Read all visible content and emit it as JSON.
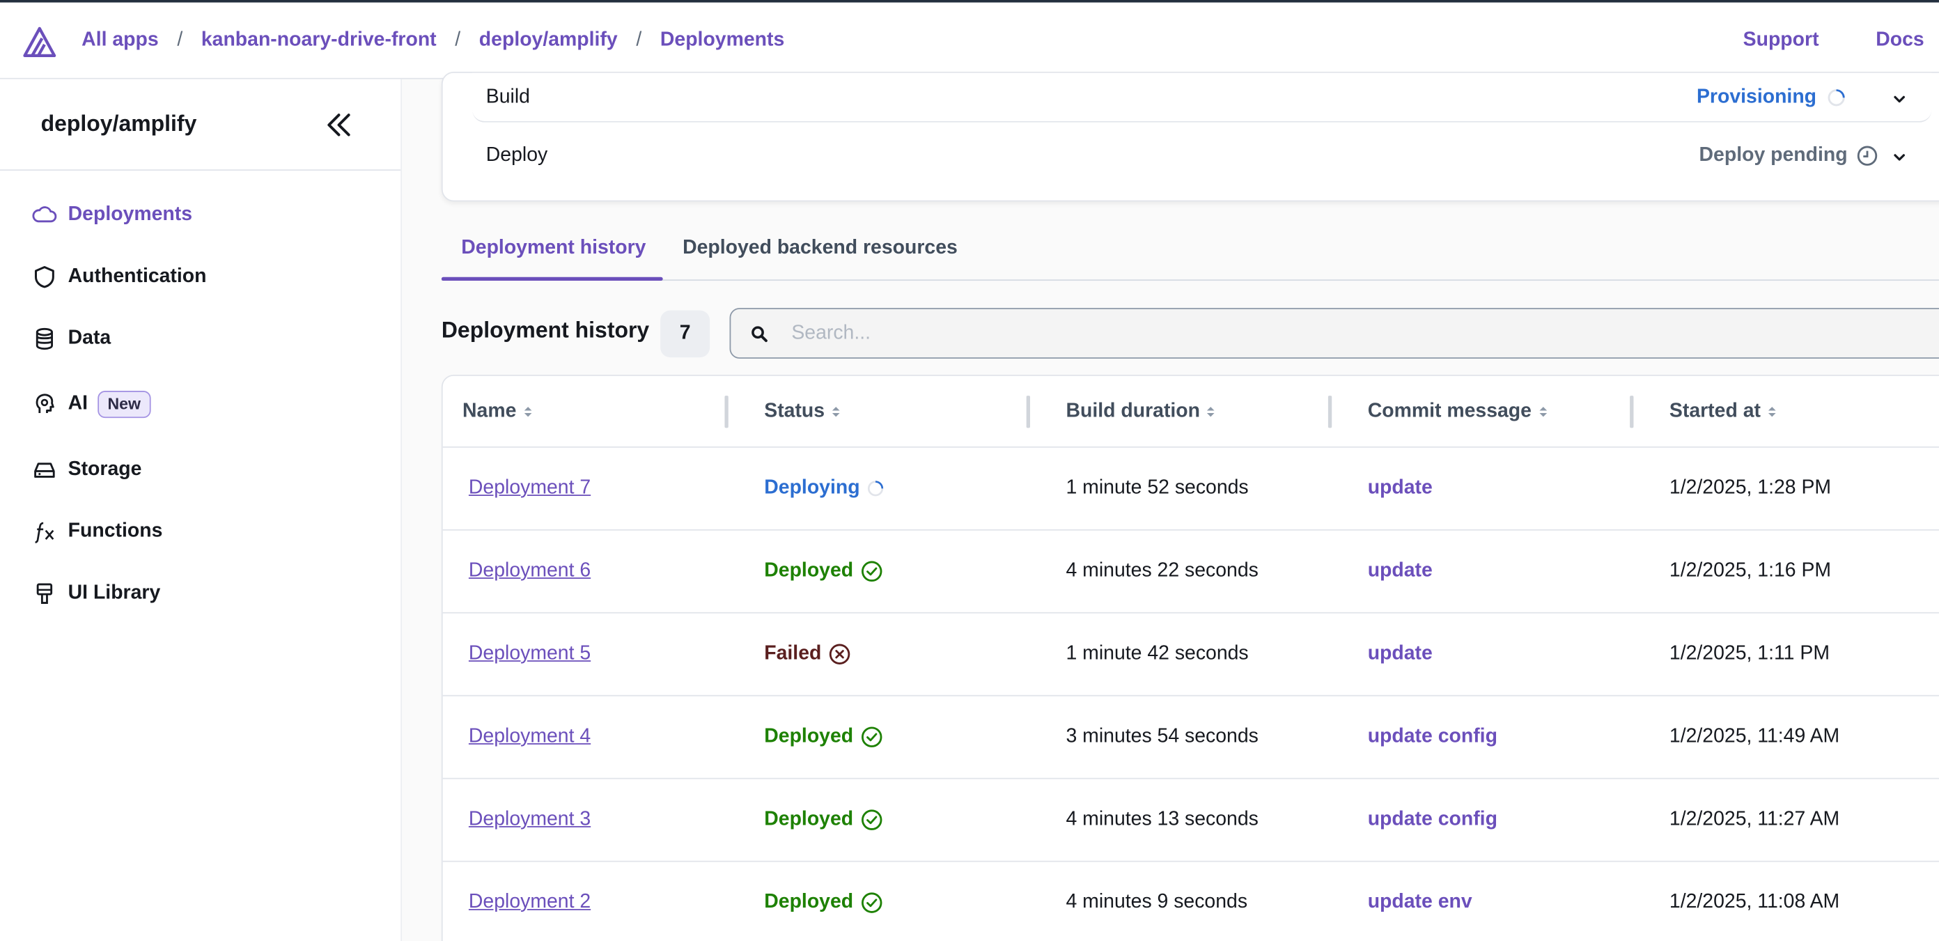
{
  "breadcrumb": {
    "items": [
      "All apps",
      "kanban-noary-drive-front",
      "deploy/amplify",
      "Deployments"
    ],
    "separator": "/"
  },
  "top_links": {
    "support": "Support",
    "docs": "Docs"
  },
  "sidebar": {
    "title": "deploy/amplify",
    "items": [
      {
        "label": "Deployments",
        "icon": "cloud-icon",
        "active": true
      },
      {
        "label": "Authentication",
        "icon": "shield-icon",
        "active": false
      },
      {
        "label": "Data",
        "icon": "database-icon",
        "active": false
      },
      {
        "label": "AI",
        "icon": "ai-brain-icon",
        "active": false,
        "badge": "New"
      },
      {
        "label": "Storage",
        "icon": "hard-drive-icon",
        "active": false
      },
      {
        "label": "Functions",
        "icon": "function-fx-icon",
        "active": false
      },
      {
        "label": "UI Library",
        "icon": "paint-brush-icon",
        "active": false
      }
    ]
  },
  "steps": {
    "build": {
      "label": "Build",
      "status": "Provisioning"
    },
    "deploy": {
      "label": "Deploy",
      "status": "Deploy pending"
    }
  },
  "tabs": [
    {
      "label": "Deployment history",
      "active": true
    },
    {
      "label": "Deployed backend resources",
      "active": false
    }
  ],
  "history": {
    "title": "Deployment history",
    "count": "7",
    "search_placeholder": "Search..."
  },
  "table": {
    "columns": [
      "Name",
      "Status",
      "Build duration",
      "Commit message",
      "Started at"
    ],
    "rows": [
      {
        "name": "Deployment 7",
        "status": "Deploying",
        "duration": "1 minute 52 seconds",
        "commit": "update",
        "started": "1/2/2025, 1:28 PM"
      },
      {
        "name": "Deployment 6",
        "status": "Deployed",
        "duration": "4 minutes 22 seconds",
        "commit": "update",
        "started": "1/2/2025, 1:16 PM"
      },
      {
        "name": "Deployment 5",
        "status": "Failed",
        "duration": "1 minute 42 seconds",
        "commit": "update",
        "started": "1/2/2025, 1:11 PM"
      },
      {
        "name": "Deployment 4",
        "status": "Deployed",
        "duration": "3 minutes 54 seconds",
        "commit": "update config",
        "started": "1/2/2025, 11:49 AM"
      },
      {
        "name": "Deployment 3",
        "status": "Deployed",
        "duration": "4 minutes 13 seconds",
        "commit": "update config",
        "started": "1/2/2025, 11:27 AM"
      },
      {
        "name": "Deployment 2",
        "status": "Deployed",
        "duration": "4 minutes 9 seconds",
        "commit": "update env",
        "started": "1/2/2025, 11:08 AM"
      }
    ]
  },
  "colors": {
    "accent": "#6b4fbb",
    "deploying": "#2c6ed1",
    "deployed": "#1d8102",
    "failed": "#5a1f1f"
  }
}
